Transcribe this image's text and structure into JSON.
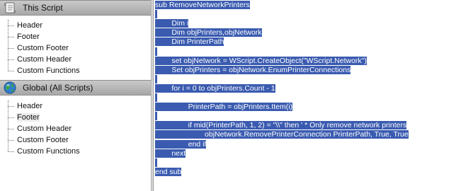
{
  "sidebar": {
    "this_script": {
      "title": "This Script",
      "items": [
        "Header",
        "Footer",
        "Custom Footer",
        "Custom Header",
        "Custom Functions"
      ]
    },
    "global": {
      "title": "Global (All Scripts)",
      "items": [
        "Header",
        "Footer",
        "Custom Header",
        "Custom Footer",
        "Custom Functions"
      ],
      "selected_index": 1
    }
  },
  "editor": {
    "lines": [
      "sub RemoveNetworkPrinters",
      "",
      "        Dim i",
      "        Dim objPrinters,objNetwork",
      "        Dim PrinterPath",
      "",
      "        set objNetwork = WScript.CreateObject(\"WScript.Network\")",
      "        Set objPrinters = objNetwork.EnumPrinterConnections",
      "",
      "        for i = 0 to objPrinters.Count - 1",
      "",
      "                PrinterPath = objPrinters.Item(i)",
      "",
      "                if mid(PrinterPath, 1, 2) = \"\\\\\" then ' * Only remove network printers",
      "                        objNetwork.RemovePrinterConnection PrinterPath, True, True",
      "                end if",
      "        next",
      "",
      "end sub"
    ]
  },
  "colors": {
    "selection": "#3a5bb0",
    "group_header_top": "#c9c9c9",
    "group_header_bottom": "#a7a7a7"
  },
  "icons": {
    "this_script": "script-scroll-icon",
    "global": "globe-icon"
  }
}
